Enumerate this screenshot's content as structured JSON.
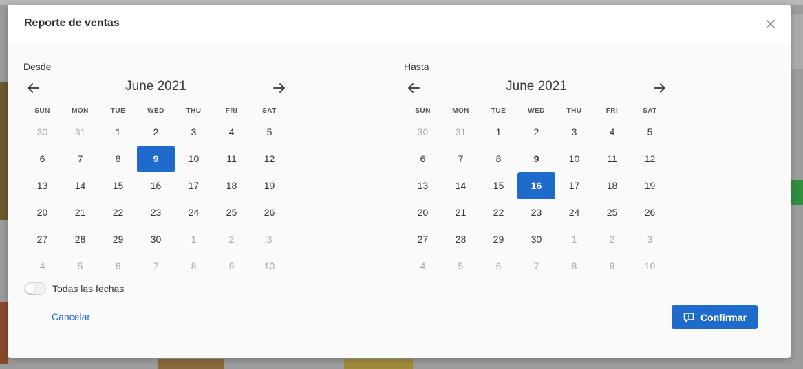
{
  "modal": {
    "title": "Reporte de ventas"
  },
  "colors": {
    "accent": "#1f6bcb",
    "muted_day": "#aaaaaa"
  },
  "weekdays": [
    "SUN",
    "MON",
    "TUE",
    "WED",
    "THU",
    "FRI",
    "SAT"
  ],
  "from": {
    "label": "Desde",
    "month": "June 2021",
    "days": [
      {
        "d": "30",
        "muted": true
      },
      {
        "d": "31",
        "muted": true
      },
      {
        "d": "1"
      },
      {
        "d": "2"
      },
      {
        "d": "3"
      },
      {
        "d": "4"
      },
      {
        "d": "5"
      },
      {
        "d": "6"
      },
      {
        "d": "7"
      },
      {
        "d": "8"
      },
      {
        "d": "9",
        "selected": true
      },
      {
        "d": "10"
      },
      {
        "d": "11"
      },
      {
        "d": "12"
      },
      {
        "d": "13"
      },
      {
        "d": "14"
      },
      {
        "d": "15"
      },
      {
        "d": "16"
      },
      {
        "d": "17"
      },
      {
        "d": "18"
      },
      {
        "d": "19"
      },
      {
        "d": "20"
      },
      {
        "d": "21"
      },
      {
        "d": "22"
      },
      {
        "d": "23"
      },
      {
        "d": "24"
      },
      {
        "d": "25"
      },
      {
        "d": "26"
      },
      {
        "d": "27"
      },
      {
        "d": "28"
      },
      {
        "d": "29"
      },
      {
        "d": "30"
      },
      {
        "d": "1",
        "muted": true
      },
      {
        "d": "2",
        "muted": true
      },
      {
        "d": "3",
        "muted": true
      },
      {
        "d": "4",
        "muted": true
      },
      {
        "d": "5",
        "muted": true
      },
      {
        "d": "6",
        "muted": true
      },
      {
        "d": "7",
        "muted": true
      },
      {
        "d": "8",
        "muted": true
      },
      {
        "d": "9",
        "muted": true
      },
      {
        "d": "10",
        "muted": true
      }
    ]
  },
  "to": {
    "label": "Hasta",
    "month": "June 2021",
    "days": [
      {
        "d": "30",
        "muted": true
      },
      {
        "d": "31",
        "muted": true
      },
      {
        "d": "1"
      },
      {
        "d": "2"
      },
      {
        "d": "3"
      },
      {
        "d": "4"
      },
      {
        "d": "5"
      },
      {
        "d": "6"
      },
      {
        "d": "7"
      },
      {
        "d": "8"
      },
      {
        "d": "9",
        "bold": true
      },
      {
        "d": "10"
      },
      {
        "d": "11"
      },
      {
        "d": "12"
      },
      {
        "d": "13"
      },
      {
        "d": "14"
      },
      {
        "d": "15"
      },
      {
        "d": "16",
        "selected": true
      },
      {
        "d": "17"
      },
      {
        "d": "18"
      },
      {
        "d": "19"
      },
      {
        "d": "20"
      },
      {
        "d": "21"
      },
      {
        "d": "22"
      },
      {
        "d": "23"
      },
      {
        "d": "24"
      },
      {
        "d": "25"
      },
      {
        "d": "26"
      },
      {
        "d": "27"
      },
      {
        "d": "28"
      },
      {
        "d": "29"
      },
      {
        "d": "30"
      },
      {
        "d": "1",
        "muted": true
      },
      {
        "d": "2",
        "muted": true
      },
      {
        "d": "3",
        "muted": true
      },
      {
        "d": "4",
        "muted": true
      },
      {
        "d": "5",
        "muted": true
      },
      {
        "d": "6",
        "muted": true
      },
      {
        "d": "7",
        "muted": true
      },
      {
        "d": "8",
        "muted": true
      },
      {
        "d": "9",
        "muted": true
      },
      {
        "d": "10",
        "muted": true
      }
    ]
  },
  "all_dates_toggle": {
    "label": "Todas las fechas",
    "on": false
  },
  "footer": {
    "cancel_label": "Cancelar",
    "confirm_label": "Confirmar",
    "confirm_icon": "chat-bubble-icon"
  }
}
